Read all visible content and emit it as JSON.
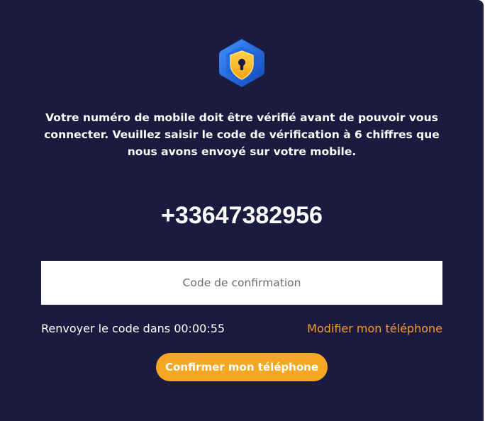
{
  "verification": {
    "logo_icon": "shield-lock-icon",
    "message": "Votre numéro de mobile doit être vérifié avant de pouvoir vous connecter. Veuillez saisir le code de vérification à 6 chiffres que nous avons envoyé sur votre mobile.",
    "phone_number": "+33647382956",
    "code_input": {
      "value": "",
      "placeholder": "Code de confirmation"
    },
    "resend_text": "Renvoyer le code dans 00:00:55",
    "modify_link": "Modifier mon téléphone",
    "confirm_button": "Confirmer mon téléphone"
  },
  "colors": {
    "background": "#1b1a3f",
    "accent": "#f5a623",
    "link": "#f39d2e",
    "logo_blue": "#1f6fe0"
  }
}
